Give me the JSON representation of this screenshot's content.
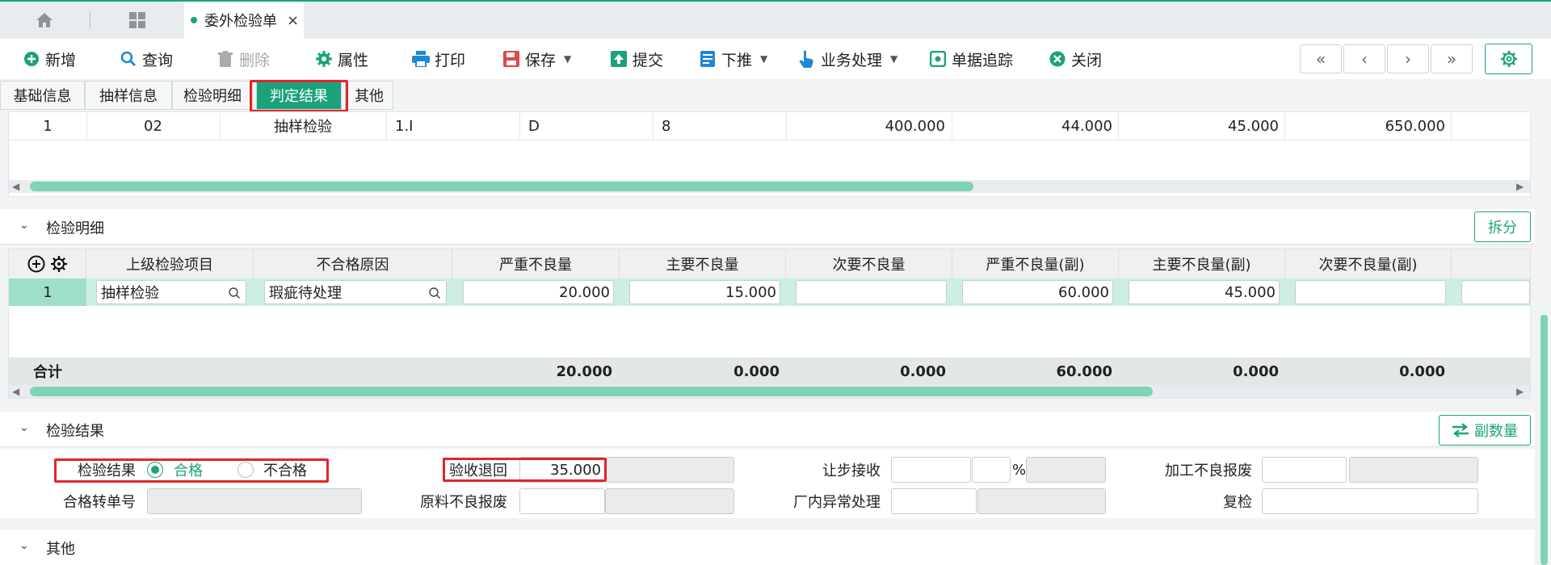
{
  "tabs": {
    "doc_tab_label": "委外检验单",
    "close_glyph": "×"
  },
  "toolbar": {
    "new": "新增",
    "query": "查询",
    "delete": "删除",
    "properties": "属性",
    "print": "打印",
    "save": "保存",
    "submit": "提交",
    "push_down": "下推",
    "business": "业务处理",
    "trace": "单据追踪",
    "close": "关闭",
    "nav_first": "«",
    "nav_prev": "‹",
    "nav_next": "›",
    "nav_last": "»"
  },
  "subtabs": [
    "基础信息",
    "抽样信息",
    "检验明细",
    "判定结果",
    "其他"
  ],
  "active_subtab": "判定结果",
  "top_grid": {
    "row": [
      "1",
      "02",
      "抽样检验",
      "1.I",
      "D",
      "8",
      "400.000",
      "44.000",
      "45.000",
      "650.000"
    ]
  },
  "detail_section": {
    "title": "检验明细",
    "split_button": "拆分",
    "headers": [
      "上级检验项目",
      "不合格原因",
      "严重不良量",
      "主要不良量",
      "次要不良量",
      "严重不良量(副)",
      "主要不良量(副)",
      "次要不良量(副)"
    ],
    "row": {
      "seq": "1",
      "parent_item": "抽样检验",
      "reason": "瑕疵待处理",
      "values": [
        "20.000",
        "15.000",
        "",
        "60.000",
        "45.000",
        ""
      ]
    },
    "total_label": "合计",
    "totals": [
      "20.000",
      "0.000",
      "0.000",
      "60.000",
      "0.000",
      "0.000"
    ]
  },
  "result_section": {
    "title": "检验结果",
    "aux_qty_button": "副数量",
    "result_label": "检验结果",
    "option_pass": "合格",
    "option_fail": "不合格",
    "selected": "合格",
    "return_label": "验收退回",
    "return_value": "35.000",
    "concession_label": "让步接收",
    "percent": "%",
    "process_scrap_label": "加工不良报废",
    "transfer_no_label": "合格转单号",
    "material_scrap_label": "原料不良报废",
    "abnormal_label": "厂内异常处理",
    "recheck_label": "复检"
  },
  "other_section": {
    "title": "其他"
  },
  "colors": {
    "accent": "#1aa37a",
    "highlight_box": "#e3242b"
  }
}
